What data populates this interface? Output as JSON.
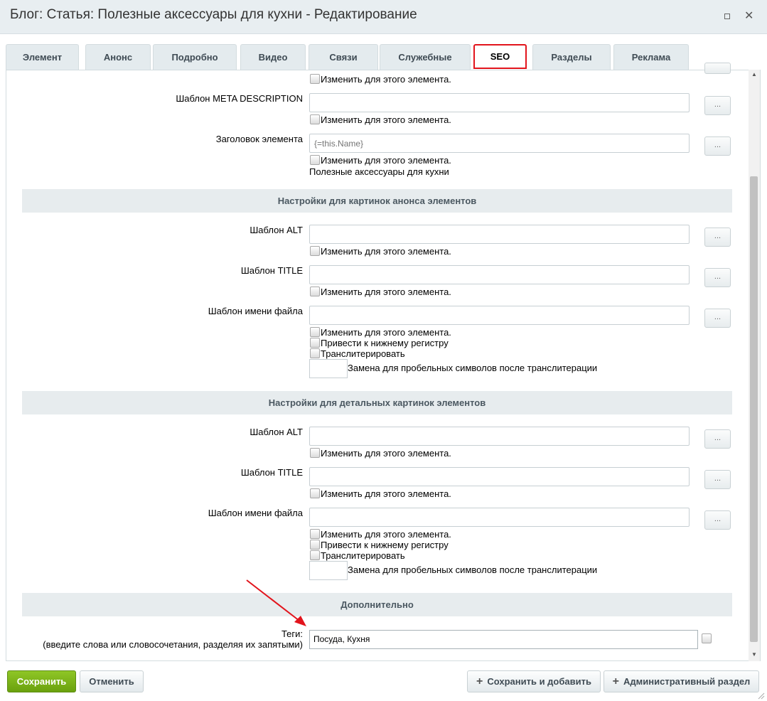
{
  "window": {
    "title": "Блог: Статья: Полезные аксессуары для кухни - Редактирование"
  },
  "tabs": [
    {
      "label": "Элемент"
    },
    {
      "label": "Анонс"
    },
    {
      "label": "Подробно"
    },
    {
      "label": "Видео"
    },
    {
      "label": "Связи"
    },
    {
      "label": "Служебные"
    },
    {
      "label": "SEO"
    },
    {
      "label": "Разделы"
    },
    {
      "label": "Реклама"
    }
  ],
  "active_tab": "SEO",
  "checkbox_change": "Изменить для этого элемента.",
  "dots": "...",
  "top": {
    "meta_description_label": "Шаблон META DESCRIPTION",
    "element_title_label": "Заголовок элемента",
    "element_title_placeholder": "{=this.Name}",
    "element_title_value": "Полезные аксессуары для кухни"
  },
  "preview_section": {
    "heading": "Настройки для картинок анонса элементов",
    "alt_label": "Шаблон ALT",
    "title_label": "Шаблон TITLE",
    "filename_label": "Шаблон имени файла",
    "lowercase_label": "Привести к нижнему регистру",
    "translit_label": "Транслитерировать",
    "space_replace_label": "Замена для пробельных символов после транслитерации"
  },
  "detail_section": {
    "heading": "Настройки для детальных картинок элементов",
    "alt_label": "Шаблон ALT",
    "title_label": "Шаблон TITLE",
    "filename_label": "Шаблон имени файла",
    "lowercase_label": "Привести к нижнему регистру",
    "translit_label": "Транслитерировать",
    "space_replace_label": "Замена для пробельных символов после транслитерации"
  },
  "extra_section": {
    "heading": "Дополнительно",
    "tags_label": "Теги:",
    "tags_hint": "(введите слова или словосочетания, разделяя их запятыми)",
    "tags_value": "Посуда, Кухня"
  },
  "buttons": {
    "save": "Сохранить",
    "cancel": "Отменить",
    "save_and_add": "Сохранить и добавить",
    "admin_section": "Административный раздел"
  },
  "colors": {
    "save_button": "#7ab51d",
    "active_tab_border": "#e2141c",
    "annotation_arrow": "#e2141c"
  }
}
